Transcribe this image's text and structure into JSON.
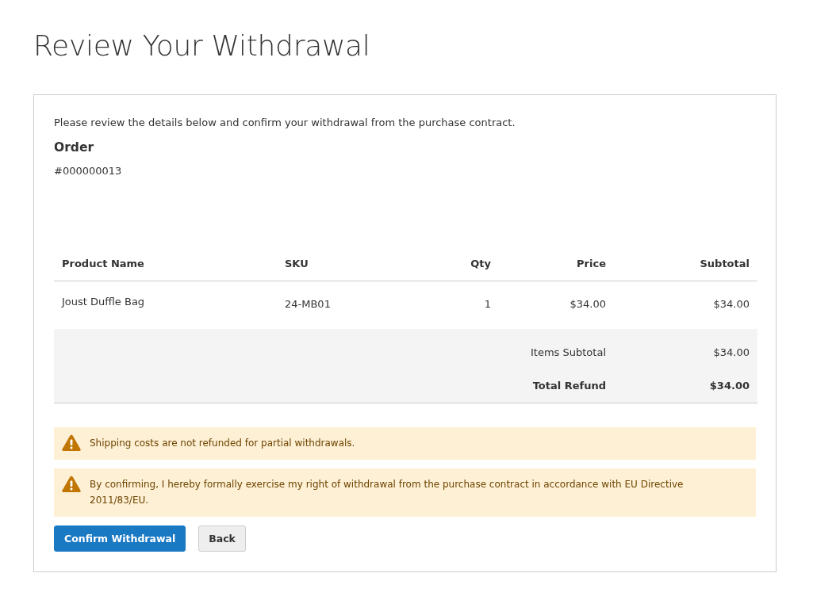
{
  "page_title": "Review Your Withdrawal",
  "intro": "Please review the details below and confirm your withdrawal from the purchase contract.",
  "order": {
    "heading": "Order",
    "number": "#000000013"
  },
  "table": {
    "columns": [
      "Product Name",
      "SKU",
      "Qty",
      "Price",
      "Subtotal"
    ],
    "rows": [
      {
        "cells": [
          "Joust Duffle Bag",
          "24-MB01",
          "1",
          "$34.00",
          "$34.00"
        ]
      }
    ],
    "totals": [
      {
        "label": "Items Subtotal",
        "value": "$34.00",
        "kind": "plain"
      },
      {
        "label": "Total Refund",
        "value": "$34.00",
        "kind": "grand"
      }
    ]
  },
  "notices": [
    {
      "kind": "warning",
      "text": "Shipping costs are not refunded for partial withdrawals."
    },
    {
      "kind": "warning",
      "text": "By confirming, I hereby formally exercise my right of withdrawal from the purchase contract in accordance with EU Directive 2011/83/EU."
    }
  ],
  "buttons": [
    {
      "label": "Confirm Withdrawal",
      "kind": "primary"
    },
    {
      "label": "Back",
      "kind": "secondary"
    }
  ]
}
